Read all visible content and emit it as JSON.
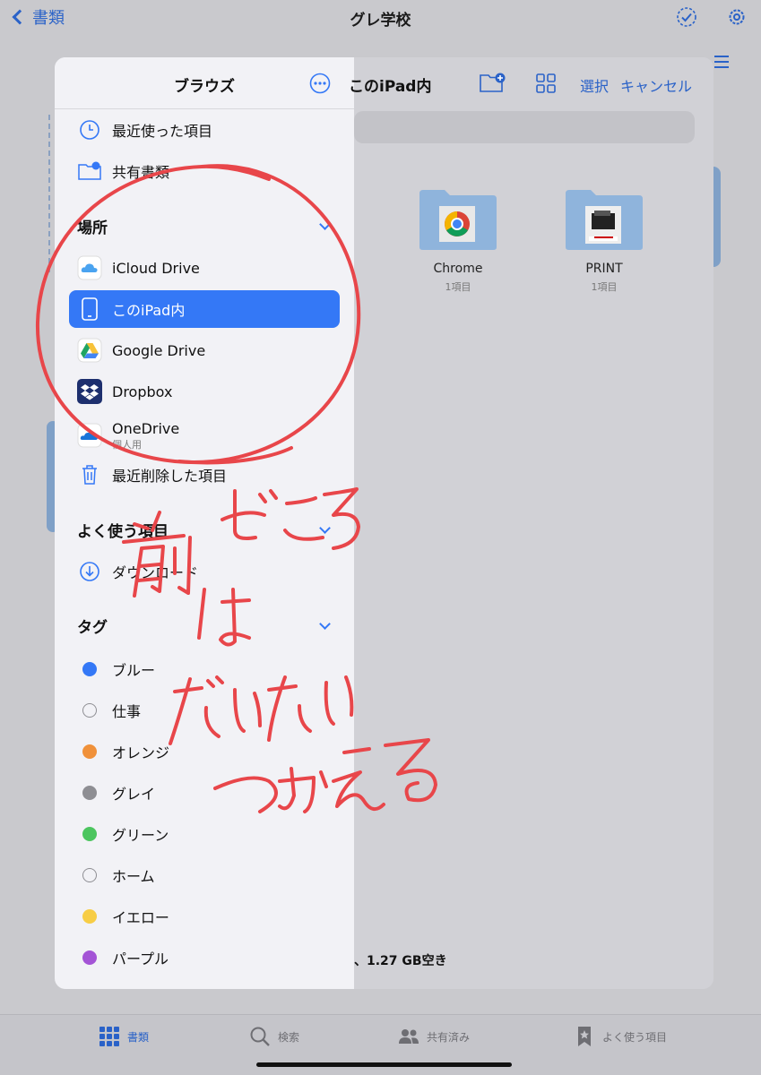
{
  "topbar": {
    "back_label": "書類",
    "title": "グレ学校",
    "list_view_icon": "list-icon",
    "select_icon": "checkmark-circle-icon",
    "settings_icon": "gear-icon"
  },
  "sidebar": {
    "title": "ブラウズ",
    "recent": "最近使った項目",
    "shared": "共有書類",
    "locations_title": "場所",
    "locations": [
      {
        "label": "iCloud Drive",
        "icon": "icloud-icon"
      },
      {
        "label": "このiPad内",
        "icon": "ipad-icon",
        "selected": true
      },
      {
        "label": "Google Drive",
        "icon": "google-drive-icon"
      },
      {
        "label": "Dropbox",
        "icon": "dropbox-icon"
      },
      {
        "label": "OneDrive",
        "sub": "個人用",
        "icon": "onedrive-icon"
      },
      {
        "label": "最近削除した項目",
        "icon": "trash-icon"
      }
    ],
    "favorites_title": "よく使う項目",
    "favorites": [
      {
        "label": "ダウンロード",
        "icon": "download-icon"
      }
    ],
    "tags_title": "タグ",
    "tags": [
      {
        "label": "ブルー",
        "color": "#3478f6"
      },
      {
        "label": "仕事",
        "color": "outline"
      },
      {
        "label": "オレンジ",
        "color": "#f0913a"
      },
      {
        "label": "グレイ",
        "color": "#8e8e93"
      },
      {
        "label": "グリーン",
        "color": "#4cc55f"
      },
      {
        "label": "ホーム",
        "color": "outline"
      },
      {
        "label": "イエロー",
        "color": "#f7cd45"
      },
      {
        "label": "パープル",
        "color": "#a454d6"
      }
    ]
  },
  "content": {
    "title": "このiPad内",
    "select_label": "選択",
    "cancel_label": "キャンセル",
    "folders": [
      {
        "name": "Chrome",
        "count": "1項目"
      },
      {
        "name": "PRINT",
        "count": "1項目"
      }
    ],
    "storage": "、1.27 GB空き"
  },
  "tabbar": {
    "tabs": [
      {
        "label": "書類",
        "icon": "grid-icon",
        "active": true
      },
      {
        "label": "検索",
        "icon": "search-icon"
      },
      {
        "label": "共有済み",
        "icon": "people-icon"
      },
      {
        "label": "よく使う項目",
        "icon": "bookmark-icon"
      }
    ]
  },
  "annotation": {
    "lines": [
      "前",
      "どころ",
      "は",
      "だいたい",
      "つかえる"
    ],
    "color": "#e8464a"
  }
}
